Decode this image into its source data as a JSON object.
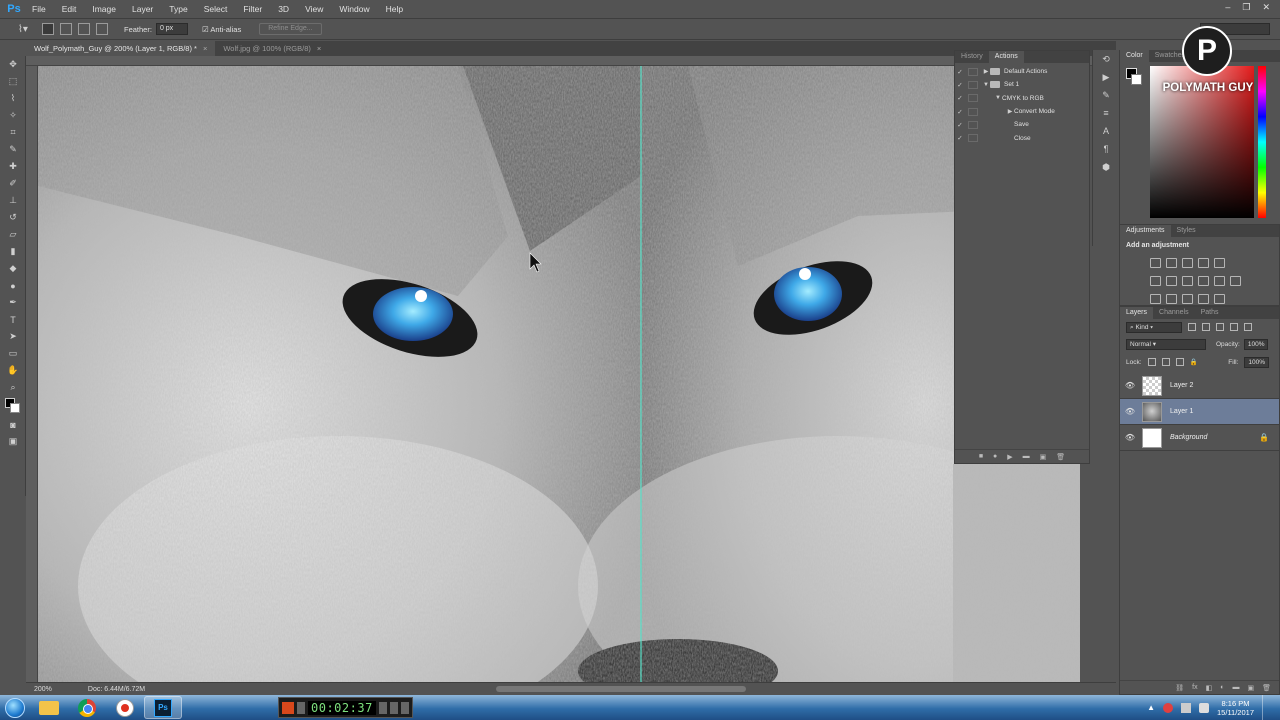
{
  "app": {
    "logo": "Ps"
  },
  "menu": [
    "File",
    "Edit",
    "Image",
    "Layer",
    "Type",
    "Select",
    "Filter",
    "3D",
    "View",
    "Window",
    "Help"
  ],
  "window_controls": {
    "minimize": "–",
    "restore": "❐",
    "close": "✕"
  },
  "options_bar": {
    "tool_icon": "lasso-icon",
    "feather_label": "Feather:",
    "feather_value": "0 px",
    "antialias_label": "Anti-alias",
    "refine_edge_label": "Refine Edge..."
  },
  "document_tabs": [
    {
      "label": "Wolf_Polymath_Guy @ 200% (Layer 1, RGB/8) *",
      "active": true
    },
    {
      "label": "Wolf.jpg @ 100% (RGB/8)",
      "active": false
    }
  ],
  "status_bar": {
    "zoom": "200%",
    "doc_info": "Doc: 6.44M/6.72M"
  },
  "history_actions_panel": {
    "tabs": [
      "History",
      "Actions"
    ],
    "active_tab": "Actions",
    "actions": [
      {
        "label": "Default Actions",
        "depth": 0,
        "expand": "▶",
        "folder": true
      },
      {
        "label": "Set 1",
        "depth": 0,
        "expand": "▼",
        "folder": true
      },
      {
        "label": "CMYK to RGB",
        "depth": 1,
        "expand": "▼",
        "folder": false
      },
      {
        "label": "Convert Mode",
        "depth": 2,
        "expand": "▶",
        "folder": false
      },
      {
        "label": "Save",
        "depth": 2,
        "expand": "",
        "folder": false
      },
      {
        "label": "Close",
        "depth": 2,
        "expand": "",
        "folder": false
      }
    ]
  },
  "color_panel": {
    "tabs": [
      "Color",
      "Swatches"
    ],
    "active_tab": "Color"
  },
  "watermark": {
    "logo_letter": "P",
    "text": "POLYMATH GUY"
  },
  "adjustments_panel": {
    "tabs": [
      "Adjustments",
      "Styles"
    ],
    "active_tab": "Adjustments",
    "title": "Add an adjustment"
  },
  "layers_panel": {
    "tabs": [
      "Layers",
      "Channels",
      "Paths"
    ],
    "active_tab": "Layers",
    "filter_kind": "Kind",
    "blend_mode": "Normal",
    "opacity_label": "Opacity:",
    "opacity_value": "100%",
    "lock_label": "Lock:",
    "fill_label": "Fill:",
    "fill_value": "100%",
    "layers": [
      {
        "name": "Layer 2",
        "selected": false,
        "thumb": "transparent",
        "italic": false,
        "locked": false
      },
      {
        "name": "Layer 1",
        "selected": true,
        "thumb": "wolf",
        "italic": false,
        "locked": false
      },
      {
        "name": "Background",
        "selected": false,
        "thumb": "white",
        "italic": true,
        "locked": true
      }
    ]
  },
  "taskbar": {
    "recorder_timer": "00:02:37",
    "clock_time": "8:16 PM",
    "clock_date": "15/11/2017"
  },
  "colors": {
    "ui_panel": "#535353",
    "selected_layer": "#6d7d99",
    "eye_blue": "#3fa9e8",
    "guide": "#58e0c8"
  }
}
